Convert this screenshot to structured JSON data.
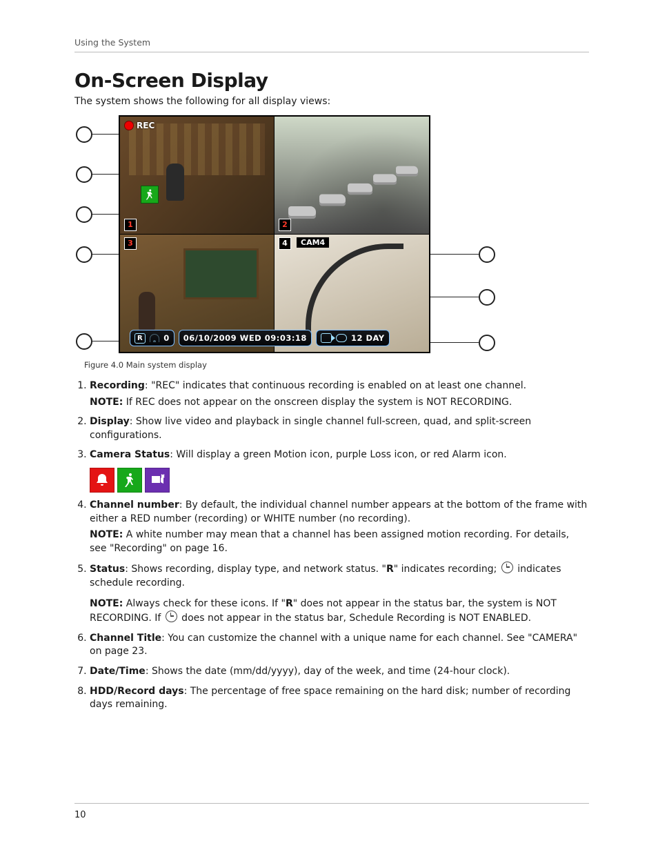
{
  "running_head": "Using the System",
  "page_number": "10",
  "title": "On-Screen Display",
  "intro": "The system shows the following for all display views:",
  "figure": {
    "caption": "Figure 4.0 Main system display",
    "rec_label": "REC",
    "cam4_label": "CAM4",
    "channels": {
      "c1": "1",
      "c2": "2",
      "c3": "3",
      "c4": "4"
    },
    "status": {
      "R": "R",
      "net_count": "0",
      "datetime": "06/10/2009  WED  09:03:18",
      "hdd_days": "12 DAY"
    }
  },
  "items": [
    {
      "term": "Recording",
      "body": ": \"REC\" indicates that continuous recording is enabled on at least one channel.",
      "note": "If REC does not appear on the onscreen display the system is NOT RECORDING."
    },
    {
      "term": "Display",
      "body": ": Show live video and playback in single channel full-screen, quad, and split-screen configurations."
    },
    {
      "term": "Camera Status",
      "body": ": Will display a green Motion icon, purple Loss icon, or red Alarm icon.",
      "icons": true
    },
    {
      "term": "Channel number",
      "body": ": By default, the individual channel number appears at the bottom of the frame with either a RED number (recording) or WHITE number (no recording).",
      "note": "A white number may mean that a channel has been assigned motion recording. For details, see \"Recording\" on page 16."
    },
    {
      "term": "Status",
      "body_pre": ": Shows recording, display type, and network status. \"",
      "body_mid_bold": "R",
      "body_mid": "\" indicates recording; ",
      "body_post": " indicates schedule recording.",
      "note_pre": "Always check for these icons. If \"",
      "note_mid_bold": "R",
      "note_mid": "\" does not appear in the status bar, the system is NOT RECORDING. If ",
      "note_post": " does not appear in the status bar, Schedule Recording is NOT ENABLED."
    },
    {
      "term": "Channel Title",
      "body": ": You can customize the channel with a unique name for each channel. See \"CAMERA\" on page 23."
    },
    {
      "term": "Date/Time",
      "body": ": Shows the date (mm/dd/yyyy), day of the week, and time (24-hour clock)."
    },
    {
      "term": "HDD/Record days",
      "body": ": The percentage of free space remaining on the hard disk; number of recording days remaining."
    }
  ],
  "note_label": "NOTE:"
}
